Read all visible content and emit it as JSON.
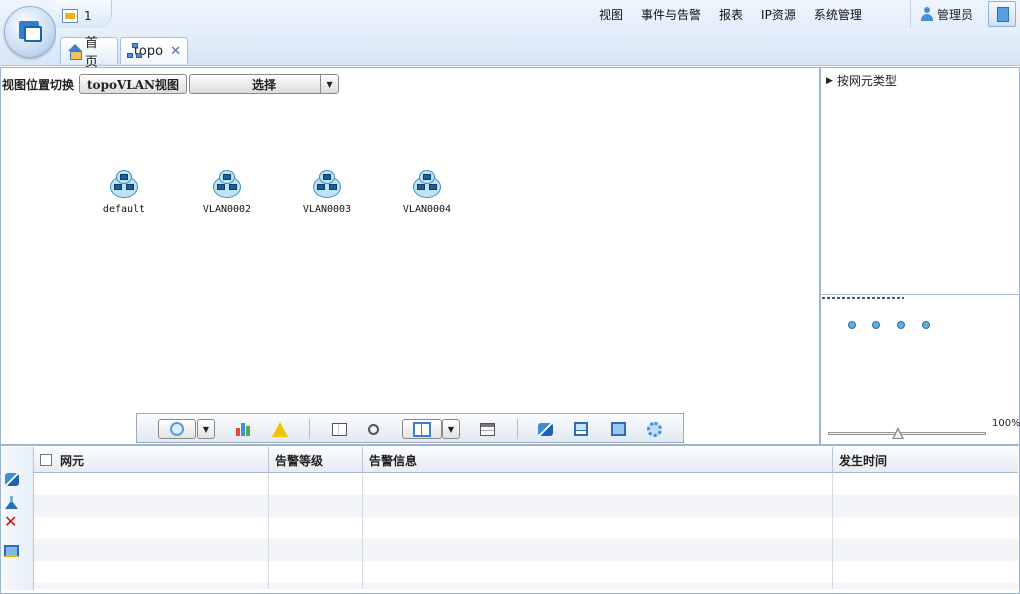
{
  "header": {
    "notification_count": "1",
    "nav": [
      "视图",
      "事件与告警",
      "报表",
      "IP资源",
      "系统管理"
    ],
    "user": "管理员"
  },
  "tabs": {
    "home": "首 页",
    "topo": "topo"
  },
  "viewbar": {
    "label": "视图位置切换",
    "vlan_button": "topoVLAN视图",
    "select_value": "选择"
  },
  "nodes": [
    "default",
    "VLAN0002",
    "VLAN0003",
    "VLAN0004"
  ],
  "right_panel": {
    "tree_item": "按网元类型",
    "zoom": "100%"
  },
  "toolbar_icons": [
    "layout-icon",
    "dropdown-icon",
    "bar-chart-icon",
    "warning-icon",
    "panel-icon",
    "magnifier-icon",
    "view-toggle-icon",
    "window-icon",
    "refresh-icon",
    "save-icon",
    "export-icon",
    "settings-icon"
  ],
  "alarm_table": {
    "columns": [
      "网元",
      "告警等级",
      "告警信息",
      "发生时间"
    ],
    "rows": []
  },
  "colors": {
    "header_bg": "#d7e6f7",
    "border": "#9db5d3",
    "accent": "#2f7ed0"
  }
}
